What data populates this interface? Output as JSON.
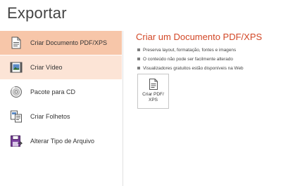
{
  "page": {
    "title": "Exportar"
  },
  "nav": {
    "items": [
      {
        "label": "Criar Documento PDF/XPS",
        "icon": "pdf-document-icon",
        "state": "selected"
      },
      {
        "label": "Criar Vídeo",
        "icon": "video-icon",
        "state": "hover"
      },
      {
        "label": "Pacote para CD",
        "icon": "cd-package-icon",
        "state": "normal"
      },
      {
        "label": "Criar Folhetos",
        "icon": "handouts-icon",
        "state": "normal"
      },
      {
        "label": "Alterar Tipo de Arquivo",
        "icon": "change-file-type-icon",
        "state": "normal"
      }
    ]
  },
  "content": {
    "title": "Criar um Documento PDF/XPS",
    "bullets": [
      "Preserva layout, formatação, fontes e imagens",
      "O conteúdo não pode ser facilmente alterado",
      "Visualizadores gratuitos estão disponíveis na Web"
    ],
    "button_label": "Criar PDF/\nXPS",
    "button_icon": "create-pdf-icon"
  },
  "colors": {
    "accent": "#d24726",
    "selected_bg": "#f7c6a9",
    "hover_bg": "#fce4d6",
    "divider": "#e1e1e1"
  }
}
